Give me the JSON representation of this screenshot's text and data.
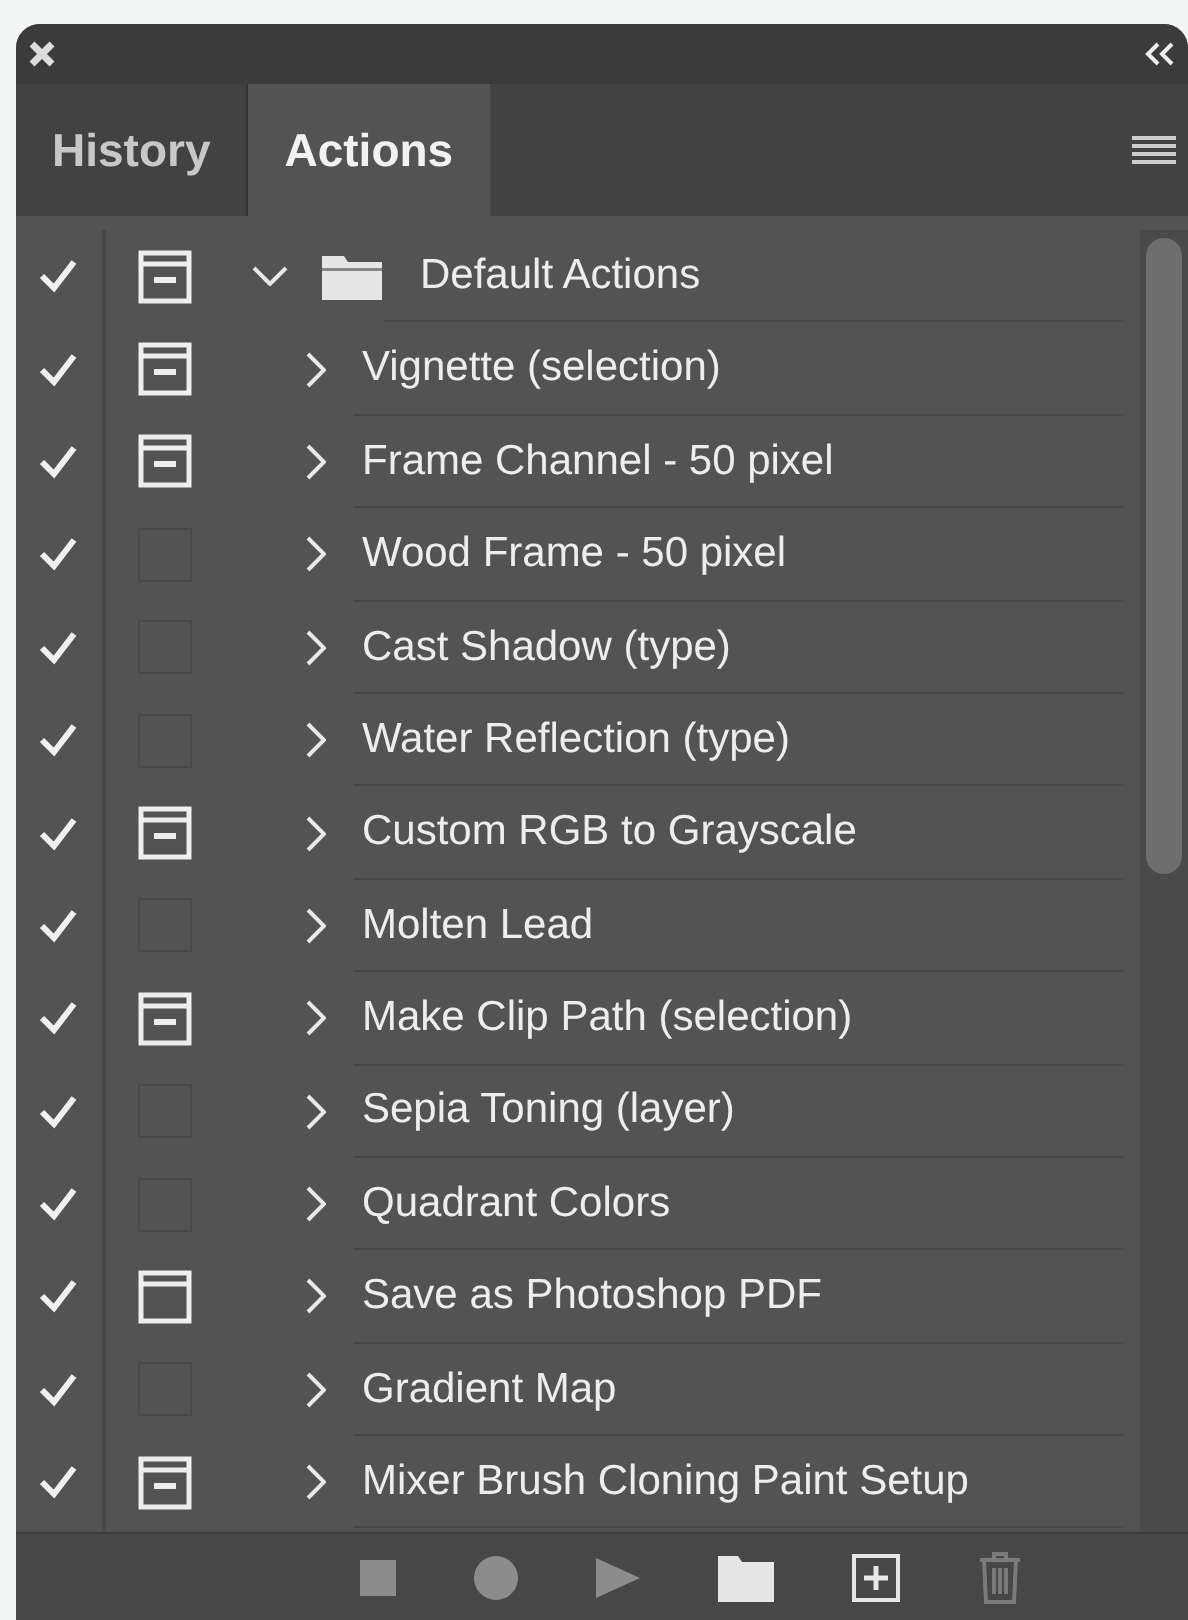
{
  "tabs": [
    {
      "label": "History",
      "selected": false
    },
    {
      "label": "Actions",
      "selected": true
    }
  ],
  "actions": [
    {
      "kind": "set",
      "name": "Default Actions",
      "enabled": true,
      "dialog_on": true,
      "dialog_all_steps": false,
      "expanded": true
    },
    {
      "kind": "action",
      "name": "Vignette (selection)",
      "enabled": true,
      "dialog_on": true,
      "dialog_all_steps": false,
      "expanded": false
    },
    {
      "kind": "action",
      "name": "Frame Channel - 50 pixel",
      "enabled": true,
      "dialog_on": true,
      "dialog_all_steps": false,
      "expanded": false
    },
    {
      "kind": "action",
      "name": "Wood Frame - 50 pixel",
      "enabled": true,
      "dialog_on": false,
      "expanded": false
    },
    {
      "kind": "action",
      "name": "Cast Shadow (type)",
      "enabled": true,
      "dialog_on": false,
      "expanded": false
    },
    {
      "kind": "action",
      "name": "Water Reflection (type)",
      "enabled": true,
      "dialog_on": false,
      "expanded": false
    },
    {
      "kind": "action",
      "name": "Custom RGB to Grayscale",
      "enabled": true,
      "dialog_on": true,
      "dialog_all_steps": false,
      "expanded": false
    },
    {
      "kind": "action",
      "name": "Molten Lead",
      "enabled": true,
      "dialog_on": false,
      "expanded": false
    },
    {
      "kind": "action",
      "name": "Make Clip Path (selection)",
      "enabled": true,
      "dialog_on": true,
      "dialog_all_steps": false,
      "expanded": false
    },
    {
      "kind": "action",
      "name": "Sepia Toning (layer)",
      "enabled": true,
      "dialog_on": false,
      "expanded": false
    },
    {
      "kind": "action",
      "name": "Quadrant Colors",
      "enabled": true,
      "dialog_on": false,
      "expanded": false
    },
    {
      "kind": "action",
      "name": "Save as Photoshop PDF",
      "enabled": true,
      "dialog_on": true,
      "dialog_all_steps": true,
      "expanded": false
    },
    {
      "kind": "action",
      "name": "Gradient Map",
      "enabled": true,
      "dialog_on": false,
      "expanded": false
    },
    {
      "kind": "action",
      "name": "Mixer Brush Cloning Paint Setup",
      "enabled": true,
      "dialog_on": true,
      "dialog_all_steps": false,
      "expanded": false
    }
  ]
}
